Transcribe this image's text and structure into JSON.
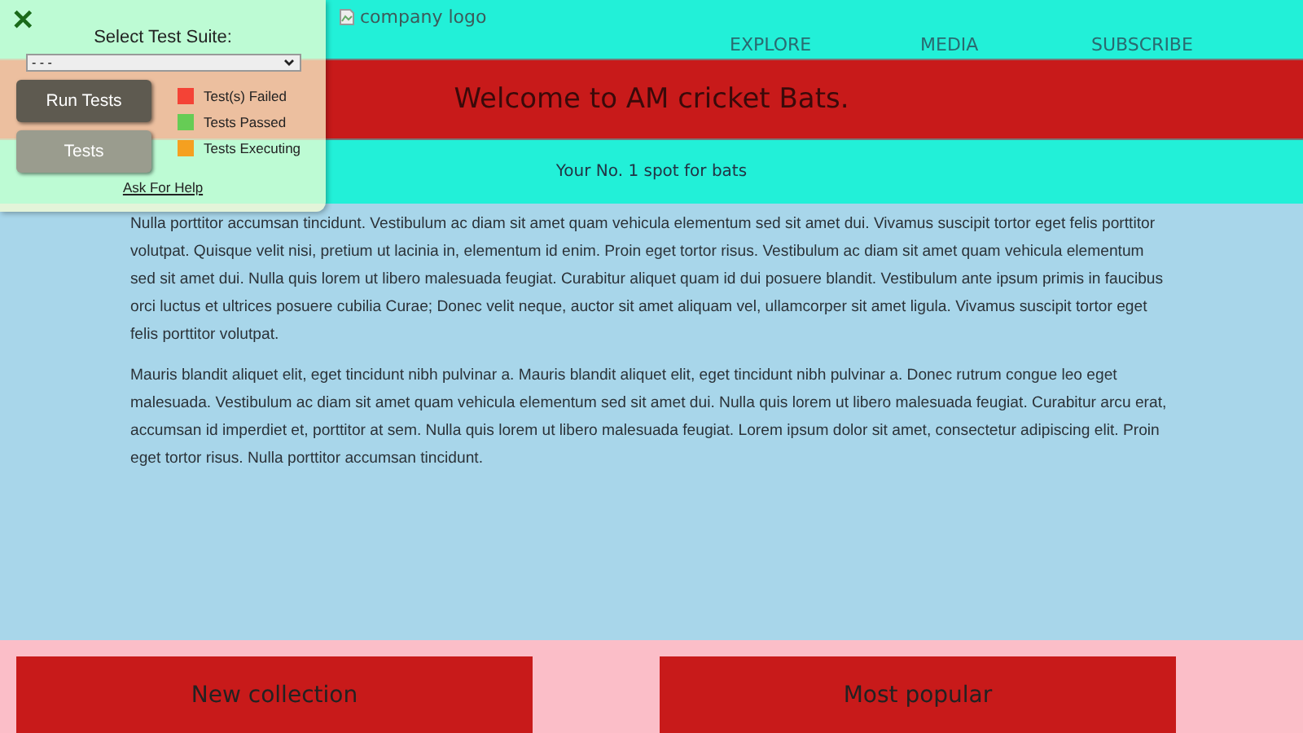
{
  "header": {
    "logo_alt": "company logo",
    "nav": [
      "EXPLORE",
      "MEDIA",
      "SUBSCRIBE"
    ]
  },
  "banner": {
    "title": "Welcome to AM cricket Bats."
  },
  "tagline": "Your No. 1 spot for bats",
  "content": {
    "paragraphs": [
      "Nulla porttitor accumsan tincidunt. Vestibulum ac diam sit amet quam vehicula elementum sed sit amet dui. Vivamus suscipit tortor eget felis porttitor volutpat. Quisque velit nisi, pretium ut lacinia in, elementum id enim. Proin eget tortor risus. Vestibulum ac diam sit amet quam vehicula elementum sed sit amet dui. Nulla quis lorem ut libero malesuada feugiat. Curabitur aliquet quam id dui posuere blandit. Vestibulum ante ipsum primis in faucibus orci luctus et ultrices posuere cubilia Curae; Donec velit neque, auctor sit amet aliquam vel, ullamcorper sit amet ligula. Vivamus suscipit tortor eget felis porttitor volutpat.",
      "Mauris blandit aliquet elit, eget tincidunt nibh pulvinar a. Mauris blandit aliquet elit, eget tincidunt nibh pulvinar a. Donec rutrum congue leo eget malesuada. Vestibulum ac diam sit amet quam vehicula elementum sed sit amet dui. Nulla quis lorem ut libero malesuada feugiat. Curabitur arcu erat, accumsan id imperdiet et, porttitor at sem. Nulla quis lorem ut libero malesuada feugiat. Lorem ipsum dolor sit amet, consectetur adipiscing elit. Proin eget tortor risus. Nulla porttitor accumsan tincidunt."
    ]
  },
  "footer": {
    "cards": [
      "New collection",
      "Most popular"
    ]
  },
  "test_panel": {
    "close": "✕",
    "label": "Select Test Suite:",
    "select_value": "- - -",
    "buttons": [
      {
        "label": "Run Tests",
        "disabled": false
      },
      {
        "label": "Tests",
        "disabled": true
      }
    ],
    "legend": [
      {
        "label": "Test(s) Failed",
        "color": "#f44336"
      },
      {
        "label": "Tests Passed",
        "color": "#66cc55"
      },
      {
        "label": "Tests Executing",
        "color": "#f5a020"
      }
    ],
    "help_link": "Ask For Help"
  }
}
